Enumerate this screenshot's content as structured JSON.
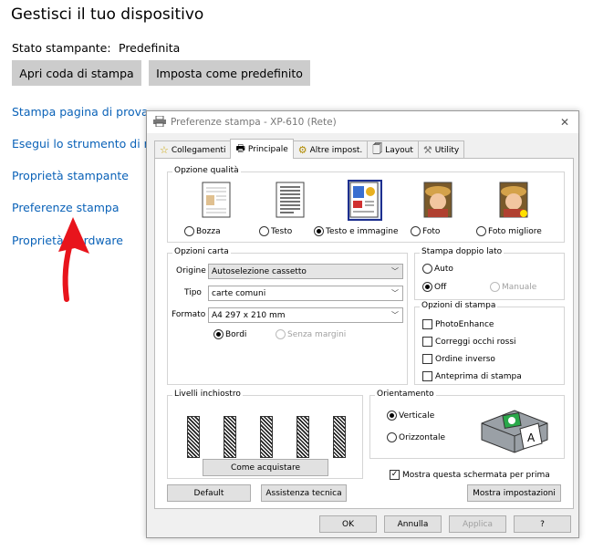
{
  "background": {
    "title": "Gestisci il tuo dispositivo",
    "status_label": "Stato stampante:",
    "status_value": "Predefinita",
    "buttons": [
      "Apri coda di stampa",
      "Imposta come predefinito"
    ],
    "links": [
      "Stampa pagina di prova",
      "Esegui lo strumento di ris",
      "Proprietà stampante",
      "Preferenze stampa",
      "Proprietà",
      "rdware"
    ]
  },
  "dialog": {
    "title": "Preferenze stampa - XP-610 (Rete)",
    "tabs": [
      "Collegamenti",
      "Principale",
      "Altre impost.",
      "Layout",
      "Utility"
    ],
    "quality": {
      "label": "Opzione qualità",
      "options": [
        "Bozza",
        "Testo",
        "Testo e immagine",
        "Foto",
        "Foto migliore"
      ]
    },
    "paper": {
      "label": "Opzioni carta",
      "source_label": "Origine",
      "source_value": "Autoselezione cassetto",
      "type_label": "Tipo",
      "type_value": "carte comuni",
      "size_label": "Formato",
      "size_value": "A4 297 x 210 mm",
      "borders": "Bordi",
      "borderless": "Senza margini"
    },
    "duplex": {
      "label": "Stampa doppio lato",
      "auto": "Auto",
      "off": "Off",
      "manual": "Manuale"
    },
    "print_options": {
      "label": "Opzioni di stampa",
      "items": [
        "PhotoEnhance",
        "Correggi occhi rossi",
        "Ordine inverso",
        "Anteprima di stampa"
      ]
    },
    "ink": {
      "label": "Livelli inchiostro",
      "buy_button": "Come acquistare"
    },
    "orientation": {
      "label": "Orientamento",
      "portrait": "Verticale",
      "landscape": "Orizzontale"
    },
    "show_screen": "Mostra questa schermata per prima",
    "buttons": {
      "default": "Default",
      "support": "Assistenza tecnica",
      "show_settings": "Mostra impostazioni",
      "ok": "OK",
      "cancel": "Annulla",
      "apply": "Applica",
      "help": "?"
    }
  }
}
